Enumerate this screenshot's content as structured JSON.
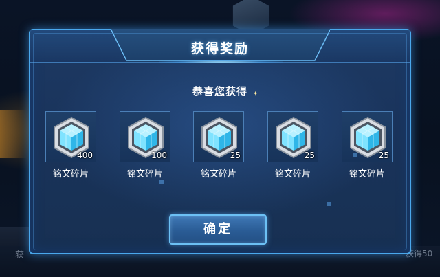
{
  "background": {
    "left_text": "获",
    "right_text": "获得50"
  },
  "dialog": {
    "title": "获得奖励",
    "subtitle": "恭喜您获得",
    "rewards": [
      {
        "label": "铭文碎片",
        "quantity": "400",
        "icon": "inscription-shard-gem-icon"
      },
      {
        "label": "铭文碎片",
        "quantity": "100",
        "icon": "inscription-shard-gem-icon"
      },
      {
        "label": "铭文碎片",
        "quantity": "25",
        "icon": "inscription-shard-gem-icon"
      },
      {
        "label": "铭文碎片",
        "quantity": "25",
        "icon": "inscription-shard-gem-icon"
      },
      {
        "label": "铭文碎片",
        "quantity": "25",
        "icon": "inscription-shard-gem-icon"
      }
    ],
    "confirm_label": "确定"
  },
  "colors": {
    "panel_border": "#4aa8ec",
    "panel_bg": "#1a345c",
    "button_bg": "#2a5c95",
    "gem_cyan": "#7fe3ff"
  }
}
